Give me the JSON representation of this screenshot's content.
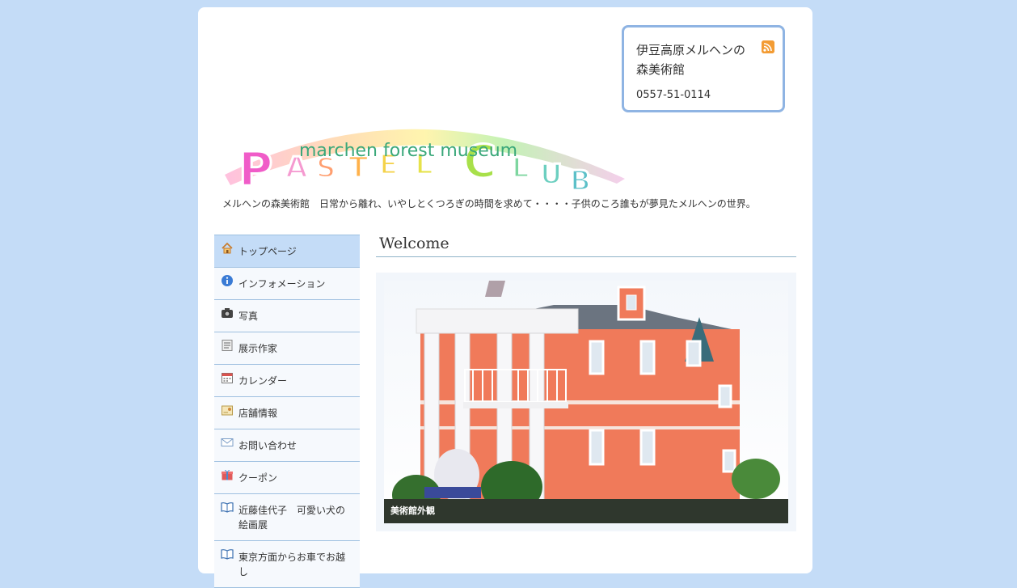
{
  "contact": {
    "name": "伊豆高原メルヘンの森美術館",
    "tel": "0557-51-0114",
    "rss_icon": "rss-icon"
  },
  "logo": {
    "subtitle": "marchen forest museum",
    "big_text": "PASTEL CLUB"
  },
  "tagline": "メルヘンの森美術館　日常から離れ、いやしとくつろぎの時間を求めて・・・・子供のころ誰もが夢見たメルヘンの世界。",
  "nav": {
    "items": [
      {
        "label": "トップページ",
        "icon": "home-icon"
      },
      {
        "label": "インフォメーション",
        "icon": "info-icon"
      },
      {
        "label": "写真",
        "icon": "camera-icon"
      },
      {
        "label": "展示作家",
        "icon": "document-icon"
      },
      {
        "label": "カレンダー",
        "icon": "calendar-icon"
      },
      {
        "label": "店舗情報",
        "icon": "shop-icon"
      },
      {
        "label": "お問い合わせ",
        "icon": "mail-icon"
      },
      {
        "label": "クーポン",
        "icon": "gift-icon"
      },
      {
        "label": "近藤佳代子　可愛い犬の絵画展",
        "icon": "book-icon"
      },
      {
        "label": "東京方面からお車でお越し",
        "icon": "book-icon"
      }
    ]
  },
  "main": {
    "heading": "Welcome",
    "photo_caption": "美術館外観"
  },
  "colors": {
    "background": "#c4dcf7",
    "accent_border": "#8fb4e3",
    "active_nav": "#c4dcf7"
  }
}
